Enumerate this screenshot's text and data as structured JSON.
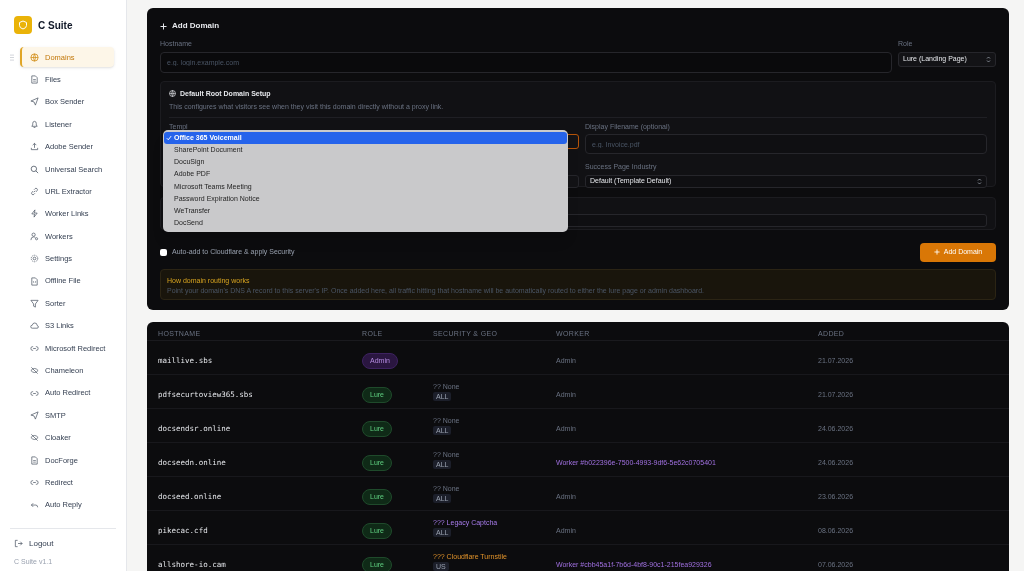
{
  "sidebar": {
    "app_title": "C Suite",
    "items": [
      {
        "label": "Domains",
        "selected": true
      },
      {
        "label": "Files",
        "selected": false
      },
      {
        "label": "Box Sender",
        "selected": false
      },
      {
        "label": "Listener",
        "selected": false
      },
      {
        "label": "Adobe Sender",
        "selected": false
      },
      {
        "label": "Universal Search",
        "selected": false
      },
      {
        "label": "URL Extractor",
        "selected": false
      },
      {
        "label": "Worker Links",
        "selected": false
      },
      {
        "label": "Workers",
        "selected": false
      },
      {
        "label": "Settings",
        "selected": false
      },
      {
        "label": "Offline File",
        "selected": false
      },
      {
        "label": "Sorter",
        "selected": false
      },
      {
        "label": "S3 Links",
        "selected": false
      },
      {
        "label": "Microsoft Redirect",
        "selected": false
      },
      {
        "label": "Chameleon",
        "selected": false
      },
      {
        "label": "Auto Redirect",
        "selected": false
      },
      {
        "label": "SMTP",
        "selected": false
      },
      {
        "label": "Cloaker",
        "selected": false
      },
      {
        "label": "DocForge",
        "selected": false
      },
      {
        "label": "Redirect",
        "selected": false
      },
      {
        "label": "Auto Reply",
        "selected": false
      }
    ],
    "logout": "Logout",
    "version": "C Suite v1.1"
  },
  "add_domain": {
    "title": "Add Domain",
    "hostname": {
      "label": "Hostname",
      "placeholder": "e.g. login.example.com"
    },
    "role": {
      "label": "Role",
      "value": "Lure (Landing Page)"
    },
    "root_setup": {
      "title": "Default Root Domain Setup",
      "description": "This configures what visitors see when they visit this domain directly without a proxy link.",
      "template": {
        "label": "Templ"
      },
      "display_filename": {
        "label": "Display Filename (optional)",
        "placeholder": "e.g. Invoice.pdf"
      },
      "success_industry": {
        "label": "Success Page Industry",
        "value": "Default (Template Default)"
      }
    },
    "template_dropdown": [
      {
        "label": "Office 365 Voicemail",
        "selected": true
      },
      {
        "label": "SharePoint Document",
        "selected": false
      },
      {
        "label": "DocuSign",
        "selected": false
      },
      {
        "label": "Adobe PDF",
        "selected": false
      },
      {
        "label": "Microsoft Teams Meeting",
        "selected": false
      },
      {
        "label": "Password Expiration Notice",
        "selected": false
      },
      {
        "label": "WeTransfer",
        "selected": false
      },
      {
        "label": "DocSend",
        "selected": false
      }
    ],
    "cloudflare": {
      "label": "Auto-add to Cloudflare & apply Security",
      "checked": false
    },
    "submit": "Add Domain",
    "info": {
      "title": "How domain routing works",
      "text": "Point your domain's DNS A record to this server's IP. Once added here, all traffic hitting that hostname will be automatically routed to either the lure page or admin dashboard."
    }
  },
  "table": {
    "columns": [
      "HOSTNAME",
      "ROLE",
      "SECURITY & GEO",
      "WORKER",
      "ADDED"
    ],
    "rows": [
      {
        "hostname": "maillive.sbs",
        "role": {
          "kind": "admin",
          "label": "Admin"
        },
        "worker": {
          "kind": "admin",
          "label": "Admin"
        },
        "added": "21.07.2026"
      },
      {
        "hostname": "pdfsecurtoview365.sbs",
        "role": {
          "kind": "lure",
          "label": "Lure"
        },
        "security": {
          "kind": "none",
          "label": "?? None",
          "geo": "ALL"
        },
        "worker": {
          "kind": "admin",
          "label": "Admin"
        },
        "added": "21.07.2026"
      },
      {
        "hostname": "docsendsr.online",
        "role": {
          "kind": "lure",
          "label": "Lure"
        },
        "security": {
          "kind": "none",
          "label": "?? None",
          "geo": "ALL"
        },
        "worker": {
          "kind": "admin",
          "label": "Admin"
        },
        "added": "24.06.2026"
      },
      {
        "hostname": "docseedn.online",
        "role": {
          "kind": "lure",
          "label": "Lure"
        },
        "security": {
          "kind": "none",
          "label": "?? None",
          "geo": "ALL"
        },
        "worker": {
          "kind": "worker",
          "label": "Worker #b022396e-7500-4993-9df6-5e62c0705401"
        },
        "added": "24.06.2026"
      },
      {
        "hostname": "docseed.online",
        "role": {
          "kind": "lure",
          "label": "Lure"
        },
        "security": {
          "kind": "none",
          "label": "?? None",
          "geo": "ALL"
        },
        "worker": {
          "kind": "admin",
          "label": "Admin"
        },
        "added": "23.06.2026"
      },
      {
        "hostname": "pikecac.cfd",
        "role": {
          "kind": "lure",
          "label": "Lure"
        },
        "security": {
          "kind": "captcha",
          "label": "??? Legacy Captcha",
          "geo": "ALL"
        },
        "worker": {
          "kind": "admin",
          "label": "Admin"
        },
        "added": "08.06.2026"
      },
      {
        "hostname": "allshore-io.cam",
        "role": {
          "kind": "lure",
          "label": "Lure"
        },
        "security": {
          "kind": "turnstile",
          "label": "??? Cloudflare Turnstile",
          "geo": "US"
        },
        "worker": {
          "kind": "worker",
          "label": "Worker #cbb45a1f-7b6d-4bf8-90c1-215fea929326"
        },
        "added": "07.06.2026"
      }
    ]
  }
}
